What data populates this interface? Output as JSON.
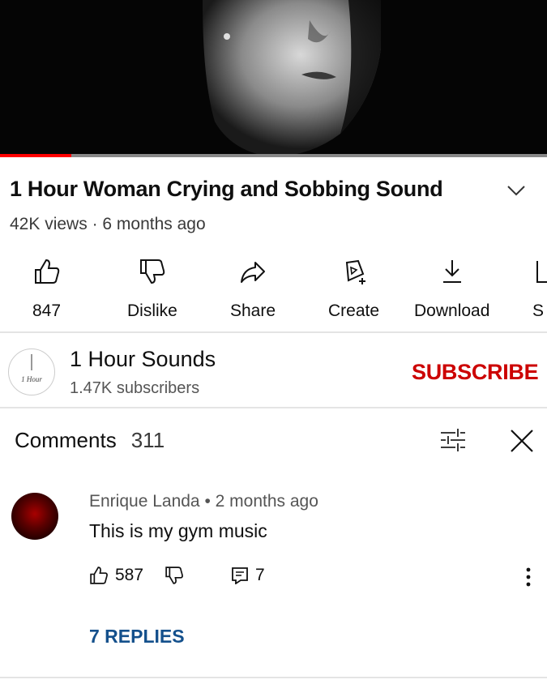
{
  "video": {
    "title": "1 Hour Woman Crying and Sobbing Sound",
    "views": "42K views",
    "age": "6 months ago",
    "progress_fraction": 0.13
  },
  "actions": [
    {
      "icon": "thumbs-up-icon",
      "label": "847"
    },
    {
      "icon": "thumbs-down-icon",
      "label": "Dislike"
    },
    {
      "icon": "share-icon",
      "label": "Share"
    },
    {
      "icon": "create-icon",
      "label": "Create"
    },
    {
      "icon": "download-icon",
      "label": "Download"
    },
    {
      "icon": "save-icon",
      "label": "S"
    }
  ],
  "channel": {
    "avatar_text": "1 Hour",
    "name": "1 Hour Sounds",
    "subscribers": "1.47K subscribers",
    "subscribe_label": "SUBSCRIBE"
  },
  "comments": {
    "label": "Comments",
    "count": "311",
    "items": [
      {
        "author": "Enrique Landa",
        "age": "2 months ago",
        "text": "This is my gym music",
        "likes": "587",
        "reply_count": "7",
        "replies_label": "7 REPLIES"
      }
    ]
  },
  "colors": {
    "accent": "#cc0000",
    "link": "#14508c",
    "progress": "#ff0000"
  }
}
